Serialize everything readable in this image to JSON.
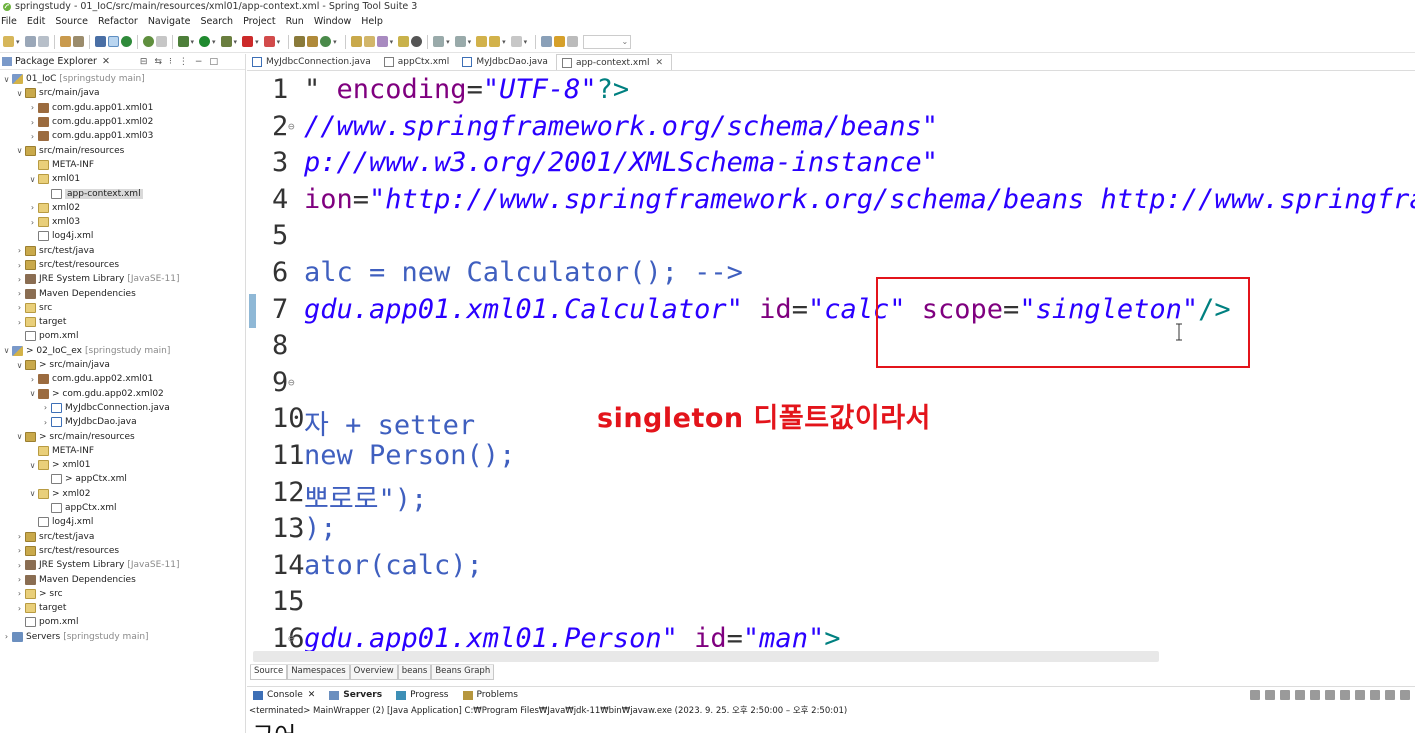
{
  "window": {
    "title": "springstudy - 01_IoC/src/main/resources/xml01/app-context.xml - Spring Tool Suite 3"
  },
  "menu": [
    "File",
    "Edit",
    "Source",
    "Refactor",
    "Navigate",
    "Search",
    "Project",
    "Run",
    "Window",
    "Help"
  ],
  "explorer": {
    "title": "Package Explorer",
    "close": "✕",
    "tree": [
      {
        "indent": 0,
        "twisty": "∨",
        "icon": "project",
        "label": "01_IoC",
        "decor": "[springstudy main]"
      },
      {
        "indent": 1,
        "twisty": "∨",
        "icon": "srcfolder",
        "label": "src/main/java",
        "decor": ""
      },
      {
        "indent": 2,
        "twisty": "›",
        "icon": "package",
        "label": "com.gdu.app01.xml01",
        "decor": ""
      },
      {
        "indent": 2,
        "twisty": "›",
        "icon": "package",
        "label": "com.gdu.app01.xml02",
        "decor": ""
      },
      {
        "indent": 2,
        "twisty": "›",
        "icon": "package",
        "label": "com.gdu.app01.xml03",
        "decor": ""
      },
      {
        "indent": 1,
        "twisty": "∨",
        "icon": "srcfolder",
        "label": "src/main/resources",
        "decor": ""
      },
      {
        "indent": 2,
        "twisty": "",
        "icon": "folder",
        "label": "META-INF",
        "decor": ""
      },
      {
        "indent": 2,
        "twisty": "∨",
        "icon": "folder",
        "label": "xml01",
        "decor": ""
      },
      {
        "indent": 3,
        "twisty": "",
        "icon": "xmlfile",
        "label": "app-context.xml",
        "decor": "",
        "selected": true
      },
      {
        "indent": 2,
        "twisty": "›",
        "icon": "folder",
        "label": "xml02",
        "decor": ""
      },
      {
        "indent": 2,
        "twisty": "›",
        "icon": "folder",
        "label": "xml03",
        "decor": ""
      },
      {
        "indent": 2,
        "twisty": "",
        "icon": "xmlfile",
        "label": "log4j.xml",
        "decor": ""
      },
      {
        "indent": 1,
        "twisty": "›",
        "icon": "srcfolder",
        "label": "src/test/java",
        "decor": ""
      },
      {
        "indent": 1,
        "twisty": "›",
        "icon": "srcfolder",
        "label": "src/test/resources",
        "decor": ""
      },
      {
        "indent": 1,
        "twisty": "›",
        "icon": "library",
        "label": "JRE System Library",
        "decor": "[JavaSE-11]"
      },
      {
        "indent": 1,
        "twisty": "›",
        "icon": "library",
        "label": "Maven Dependencies",
        "decor": ""
      },
      {
        "indent": 1,
        "twisty": "›",
        "icon": "folder",
        "label": "src",
        "decor": ""
      },
      {
        "indent": 1,
        "twisty": "›",
        "icon": "folder",
        "label": "target",
        "decor": ""
      },
      {
        "indent": 1,
        "twisty": "",
        "icon": "xmlfile",
        "label": "pom.xml",
        "decor": ""
      },
      {
        "indent": 0,
        "twisty": "∨",
        "icon": "project",
        "label": "> 02_IoC_ex",
        "decor": "[springstudy main]"
      },
      {
        "indent": 1,
        "twisty": "∨",
        "icon": "srcfolder",
        "label": "> src/main/java",
        "decor": ""
      },
      {
        "indent": 2,
        "twisty": "›",
        "icon": "package",
        "label": "com.gdu.app02.xml01",
        "decor": ""
      },
      {
        "indent": 2,
        "twisty": "∨",
        "icon": "package",
        "label": "> com.gdu.app02.xml02",
        "decor": ""
      },
      {
        "indent": 3,
        "twisty": "›",
        "icon": "javafile",
        "label": "MyJdbcConnection.java",
        "decor": ""
      },
      {
        "indent": 3,
        "twisty": "›",
        "icon": "javafile",
        "label": "MyJdbcDao.java",
        "decor": ""
      },
      {
        "indent": 1,
        "twisty": "∨",
        "icon": "srcfolder",
        "label": "> src/main/resources",
        "decor": ""
      },
      {
        "indent": 2,
        "twisty": "",
        "icon": "folder",
        "label": "META-INF",
        "decor": ""
      },
      {
        "indent": 2,
        "twisty": "∨",
        "icon": "folder",
        "label": "> xml01",
        "decor": ""
      },
      {
        "indent": 3,
        "twisty": "",
        "icon": "xmlfile",
        "label": "> appCtx.xml",
        "decor": ""
      },
      {
        "indent": 2,
        "twisty": "∨",
        "icon": "folder",
        "label": "> xml02",
        "decor": ""
      },
      {
        "indent": 3,
        "twisty": "",
        "icon": "xmlfile",
        "label": "appCtx.xml",
        "decor": ""
      },
      {
        "indent": 2,
        "twisty": "",
        "icon": "xmlfile",
        "label": "log4j.xml",
        "decor": ""
      },
      {
        "indent": 1,
        "twisty": "›",
        "icon": "srcfolder",
        "label": "src/test/java",
        "decor": ""
      },
      {
        "indent": 1,
        "twisty": "›",
        "icon": "srcfolder",
        "label": "src/test/resources",
        "decor": ""
      },
      {
        "indent": 1,
        "twisty": "›",
        "icon": "library",
        "label": "JRE System Library",
        "decor": "[JavaSE-11]"
      },
      {
        "indent": 1,
        "twisty": "›",
        "icon": "library",
        "label": "Maven Dependencies",
        "decor": ""
      },
      {
        "indent": 1,
        "twisty": "›",
        "icon": "folder",
        "label": "> src",
        "decor": ""
      },
      {
        "indent": 1,
        "twisty": "›",
        "icon": "folder",
        "label": "target",
        "decor": ""
      },
      {
        "indent": 1,
        "twisty": "",
        "icon": "xmlfile",
        "label": "pom.xml",
        "decor": ""
      },
      {
        "indent": 0,
        "twisty": "›",
        "icon": "server",
        "label": "Servers",
        "decor": "[springstudy main]"
      }
    ]
  },
  "editor_tabs": [
    {
      "label": "MyJdbcConnection.java",
      "icon": "javafile",
      "active": false
    },
    {
      "label": "appCtx.xml",
      "icon": "xmlfile",
      "active": false
    },
    {
      "label": "MyJdbcDao.java",
      "icon": "javafile",
      "active": false
    },
    {
      "label": "app-context.xml",
      "icon": "xmlfile",
      "active": true,
      "close": "✕"
    }
  ],
  "code_lines": [
    {
      "num": "1",
      "fold": "",
      "tokens": [
        [
          "plain",
          "\" "
        ],
        [
          "attr",
          "encoding"
        ],
        [
          "plain",
          "="
        ],
        [
          "val",
          "\"UTF-8\""
        ],
        [
          "punct",
          "?>"
        ]
      ]
    },
    {
      "num": "2",
      "fold": "⊖",
      "tokens": [
        [
          "val",
          "//www.springframework.org/schema/beans\""
        ]
      ]
    },
    {
      "num": "3",
      "fold": "",
      "tokens": [
        [
          "val",
          "p://www.w3.org/2001/XMLSchema-instance\""
        ]
      ]
    },
    {
      "num": "4",
      "fold": "",
      "tokens": [
        [
          "attr",
          "ion"
        ],
        [
          "plain",
          "="
        ],
        [
          "val",
          "\"http://www.springframework.org/schema/beans http://www.springfram"
        ]
      ]
    },
    {
      "num": "5",
      "fold": "",
      "tokens": []
    },
    {
      "num": "6",
      "fold": "",
      "tokens": [
        [
          "cmt",
          "alc = new Calculator(); -->"
        ]
      ]
    },
    {
      "num": "7",
      "fold": "",
      "tokens": [
        [
          "val",
          "gdu.app01.xml01.Calculator\""
        ],
        [
          "plain",
          " "
        ],
        [
          "attr",
          "id"
        ],
        [
          "plain",
          "="
        ],
        [
          "val",
          "\"calc\""
        ],
        [
          "plain",
          " "
        ],
        [
          "attr",
          "scope"
        ],
        [
          "plain",
          "="
        ],
        [
          "val",
          "\"singleton\""
        ],
        [
          "punct",
          "/>"
        ]
      ]
    },
    {
      "num": "8",
      "fold": "",
      "tokens": []
    },
    {
      "num": "9",
      "fold": "⊖",
      "tokens": []
    },
    {
      "num": "10",
      "fold": "",
      "tokens": [
        [
          "cmt",
          "자 + setter"
        ]
      ]
    },
    {
      "num": "11",
      "fold": "",
      "tokens": [
        [
          "cmt",
          "new Person();"
        ]
      ]
    },
    {
      "num": "12",
      "fold": "",
      "tokens": [
        [
          "cmt",
          "뽀로로\");"
        ]
      ]
    },
    {
      "num": "13",
      "fold": "",
      "tokens": [
        [
          "cmt",
          ");"
        ]
      ]
    },
    {
      "num": "14",
      "fold": "",
      "tokens": [
        [
          "cmt",
          "ator(calc);"
        ]
      ]
    },
    {
      "num": "15",
      "fold": "",
      "tokens": []
    },
    {
      "num": "16",
      "fold": "⊖",
      "tokens": [
        [
          "val",
          "gdu.app01.xml01.Person\""
        ],
        [
          "plain",
          " "
        ],
        [
          "attr",
          "id"
        ],
        [
          "plain",
          "="
        ],
        [
          "val",
          "\"man\""
        ],
        [
          "punct",
          ">"
        ]
      ]
    }
  ],
  "annotation": {
    "text": "singleton 디폴트값이라서",
    "color": "#e3141b"
  },
  "bottom_tabs": [
    "Source",
    "Namespaces",
    "Overview",
    "beans",
    "Beans Graph"
  ],
  "console_tabs": [
    {
      "label": "Console",
      "close": "✕",
      "active": false
    },
    {
      "label": "Servers",
      "active": true
    },
    {
      "label": "Progress",
      "active": false
    },
    {
      "label": "Problems",
      "active": false
    }
  ],
  "console_status": "<terminated> MainWrapper (2) [Java Application] C:₩Program Files₩Java₩jdk-11₩bin₩javaw.exe  (2023. 9. 25. 오후 2:50:00 – 오후 2:50:01)",
  "console_output": "구어",
  "colors": {
    "xml_attr": "#7f007f",
    "xml_value": "#2a00ff",
    "xml_punct": "#008080",
    "highlight": "#e3141b"
  }
}
